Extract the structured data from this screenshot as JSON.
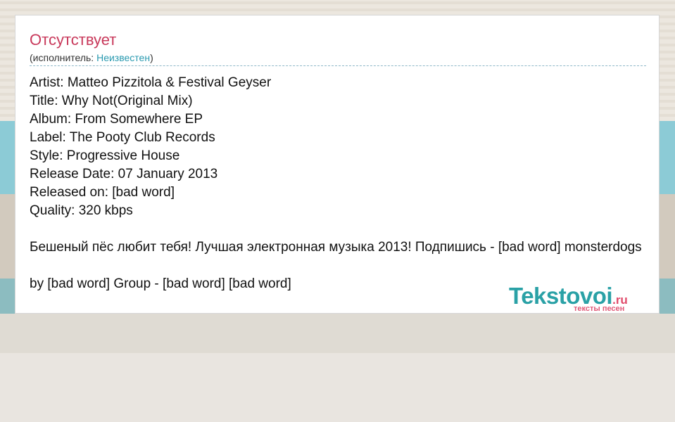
{
  "song": {
    "title": "Отсутствует",
    "artist_prefix": "(исполнитель: ",
    "artist_name": "Неизвестен",
    "artist_suffix": ")"
  },
  "lyrics": [
    "Artist: Matteo Pizzitola & Festival Geyser",
    "Title: Why Not(Original Mix)",
    "Album: From Somewhere EP",
    "Label: The Pooty Club Records",
    "Style: Progressive House",
    "Release Date: 07 January 2013",
    "Released on: [bad word]",
    "Quality: 320 kbps",
    "",
    "Бешеный пёс любит тебя! Лучшая электронная музыка 2013! Подпишись - [bad word] monsterdogs",
    "",
    "by [bad word] Group - [bad word] [bad word]"
  ],
  "logo": {
    "main": "Tekstovoi",
    "tld": ".ru",
    "tagline": "тексты песен"
  },
  "colors": {
    "title": "#c8385a",
    "link": "#2a9ab0",
    "logo_main": "#2aa1a6",
    "logo_accent": "#e04a6a"
  }
}
